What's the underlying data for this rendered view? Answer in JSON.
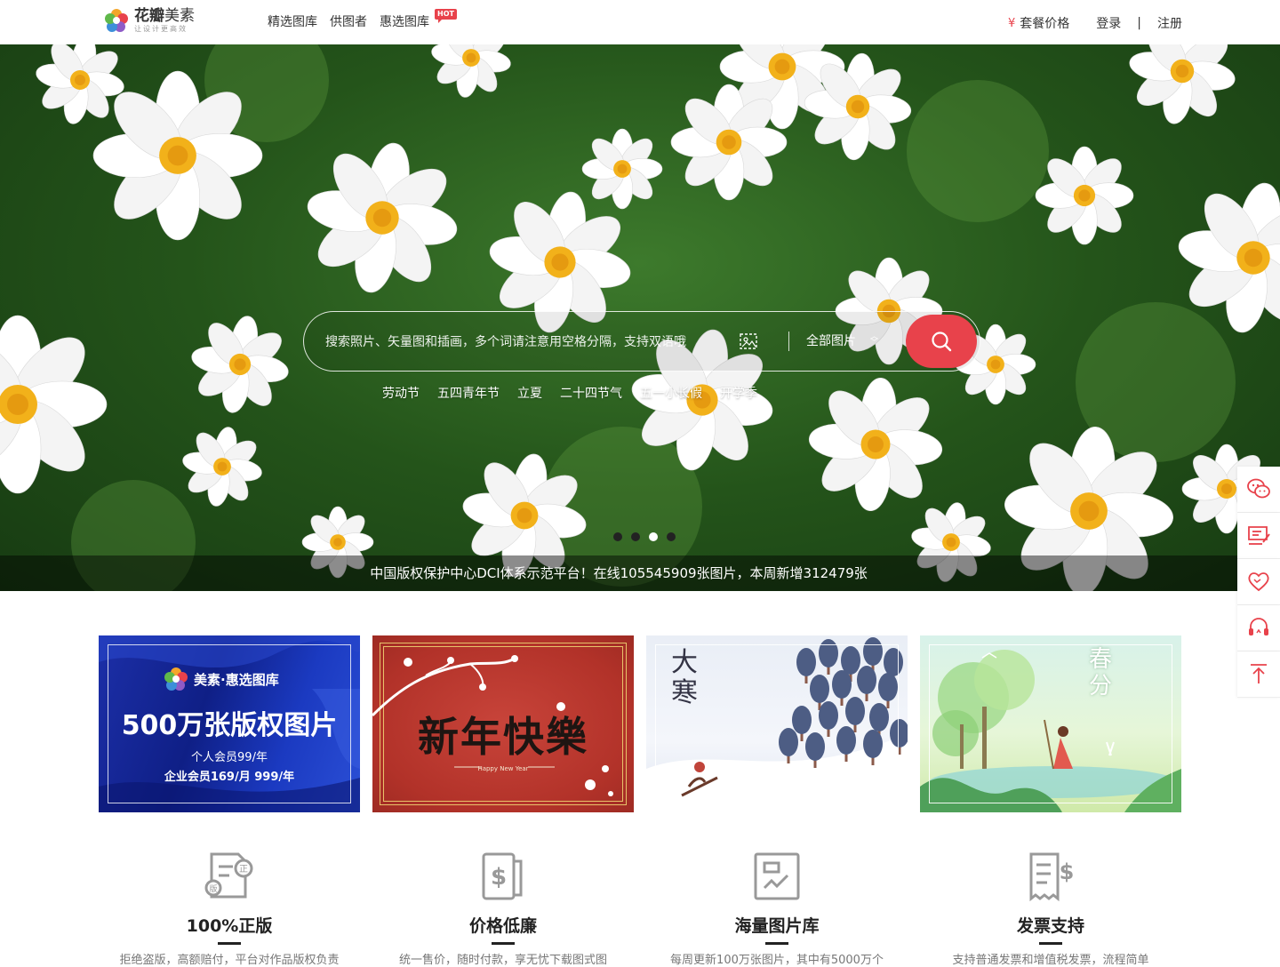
{
  "header": {
    "logo": {
      "name_bold": "花瓣",
      "name_regular": "美素",
      "slogan": "让设计更高效"
    },
    "nav": [
      {
        "label": "精选图库"
      },
      {
        "label": "供图者"
      },
      {
        "label": "惠选图库",
        "badge": "HOT"
      }
    ],
    "pricing": {
      "icon": "¥",
      "label": "套餐价格"
    },
    "login_label": "登录",
    "separator": "|",
    "register_label": "注册"
  },
  "hero": {
    "search": {
      "placeholder": "搜索照片、矢量图和插画，多个词请注意用空格分隔，支持双语哦",
      "type_selected": "全部图片",
      "image_search_icon": "image-search-icon",
      "submit_icon": "search-icon"
    },
    "hot_tags": [
      "劳动节",
      "五四青年节",
      "立夏",
      "二十四节气",
      "五一小长假",
      "开学季"
    ],
    "carousel": {
      "count": 4,
      "active_index": 2
    },
    "copyright_text": "中国版权保护中心DCI体系示范平台！在线105545909张图片，本周新增312479张"
  },
  "float_bar": [
    {
      "icon": "wechat-icon"
    },
    {
      "icon": "feedback-icon"
    },
    {
      "icon": "heart-icon"
    },
    {
      "icon": "headset-icon"
    },
    {
      "icon": "back-to-top-icon"
    }
  ],
  "banners": {
    "b1": {
      "brand": "美素·惠选图库",
      "title": "500万张版权图片",
      "line1": "个人会员99/年",
      "line2": "企业会员169/月 999/年"
    },
    "b2": {
      "title": "新年快樂",
      "subtitle": "Happy New Year"
    },
    "b3": {
      "title": "大寒"
    },
    "b4": {
      "title": "春分"
    }
  },
  "features": [
    {
      "icon": "copyright-document-icon",
      "title": "100%正版",
      "desc": "拒绝盗版，高额赔付，平台对作品版权负责"
    },
    {
      "icon": "price-document-icon",
      "title": "价格低廉",
      "desc": "统一售价，随时付款，享无忧下载图式图"
    },
    {
      "icon": "gallery-icon",
      "title": "海量图片库",
      "desc": "每周更新100万张图片，其中有5000万个"
    },
    {
      "icon": "invoice-icon",
      "title": "发票支持",
      "desc": "支持普通发票和增值税发票，流程简单"
    }
  ],
  "colors": {
    "accent": "#e8424b",
    "text": "#333333"
  }
}
